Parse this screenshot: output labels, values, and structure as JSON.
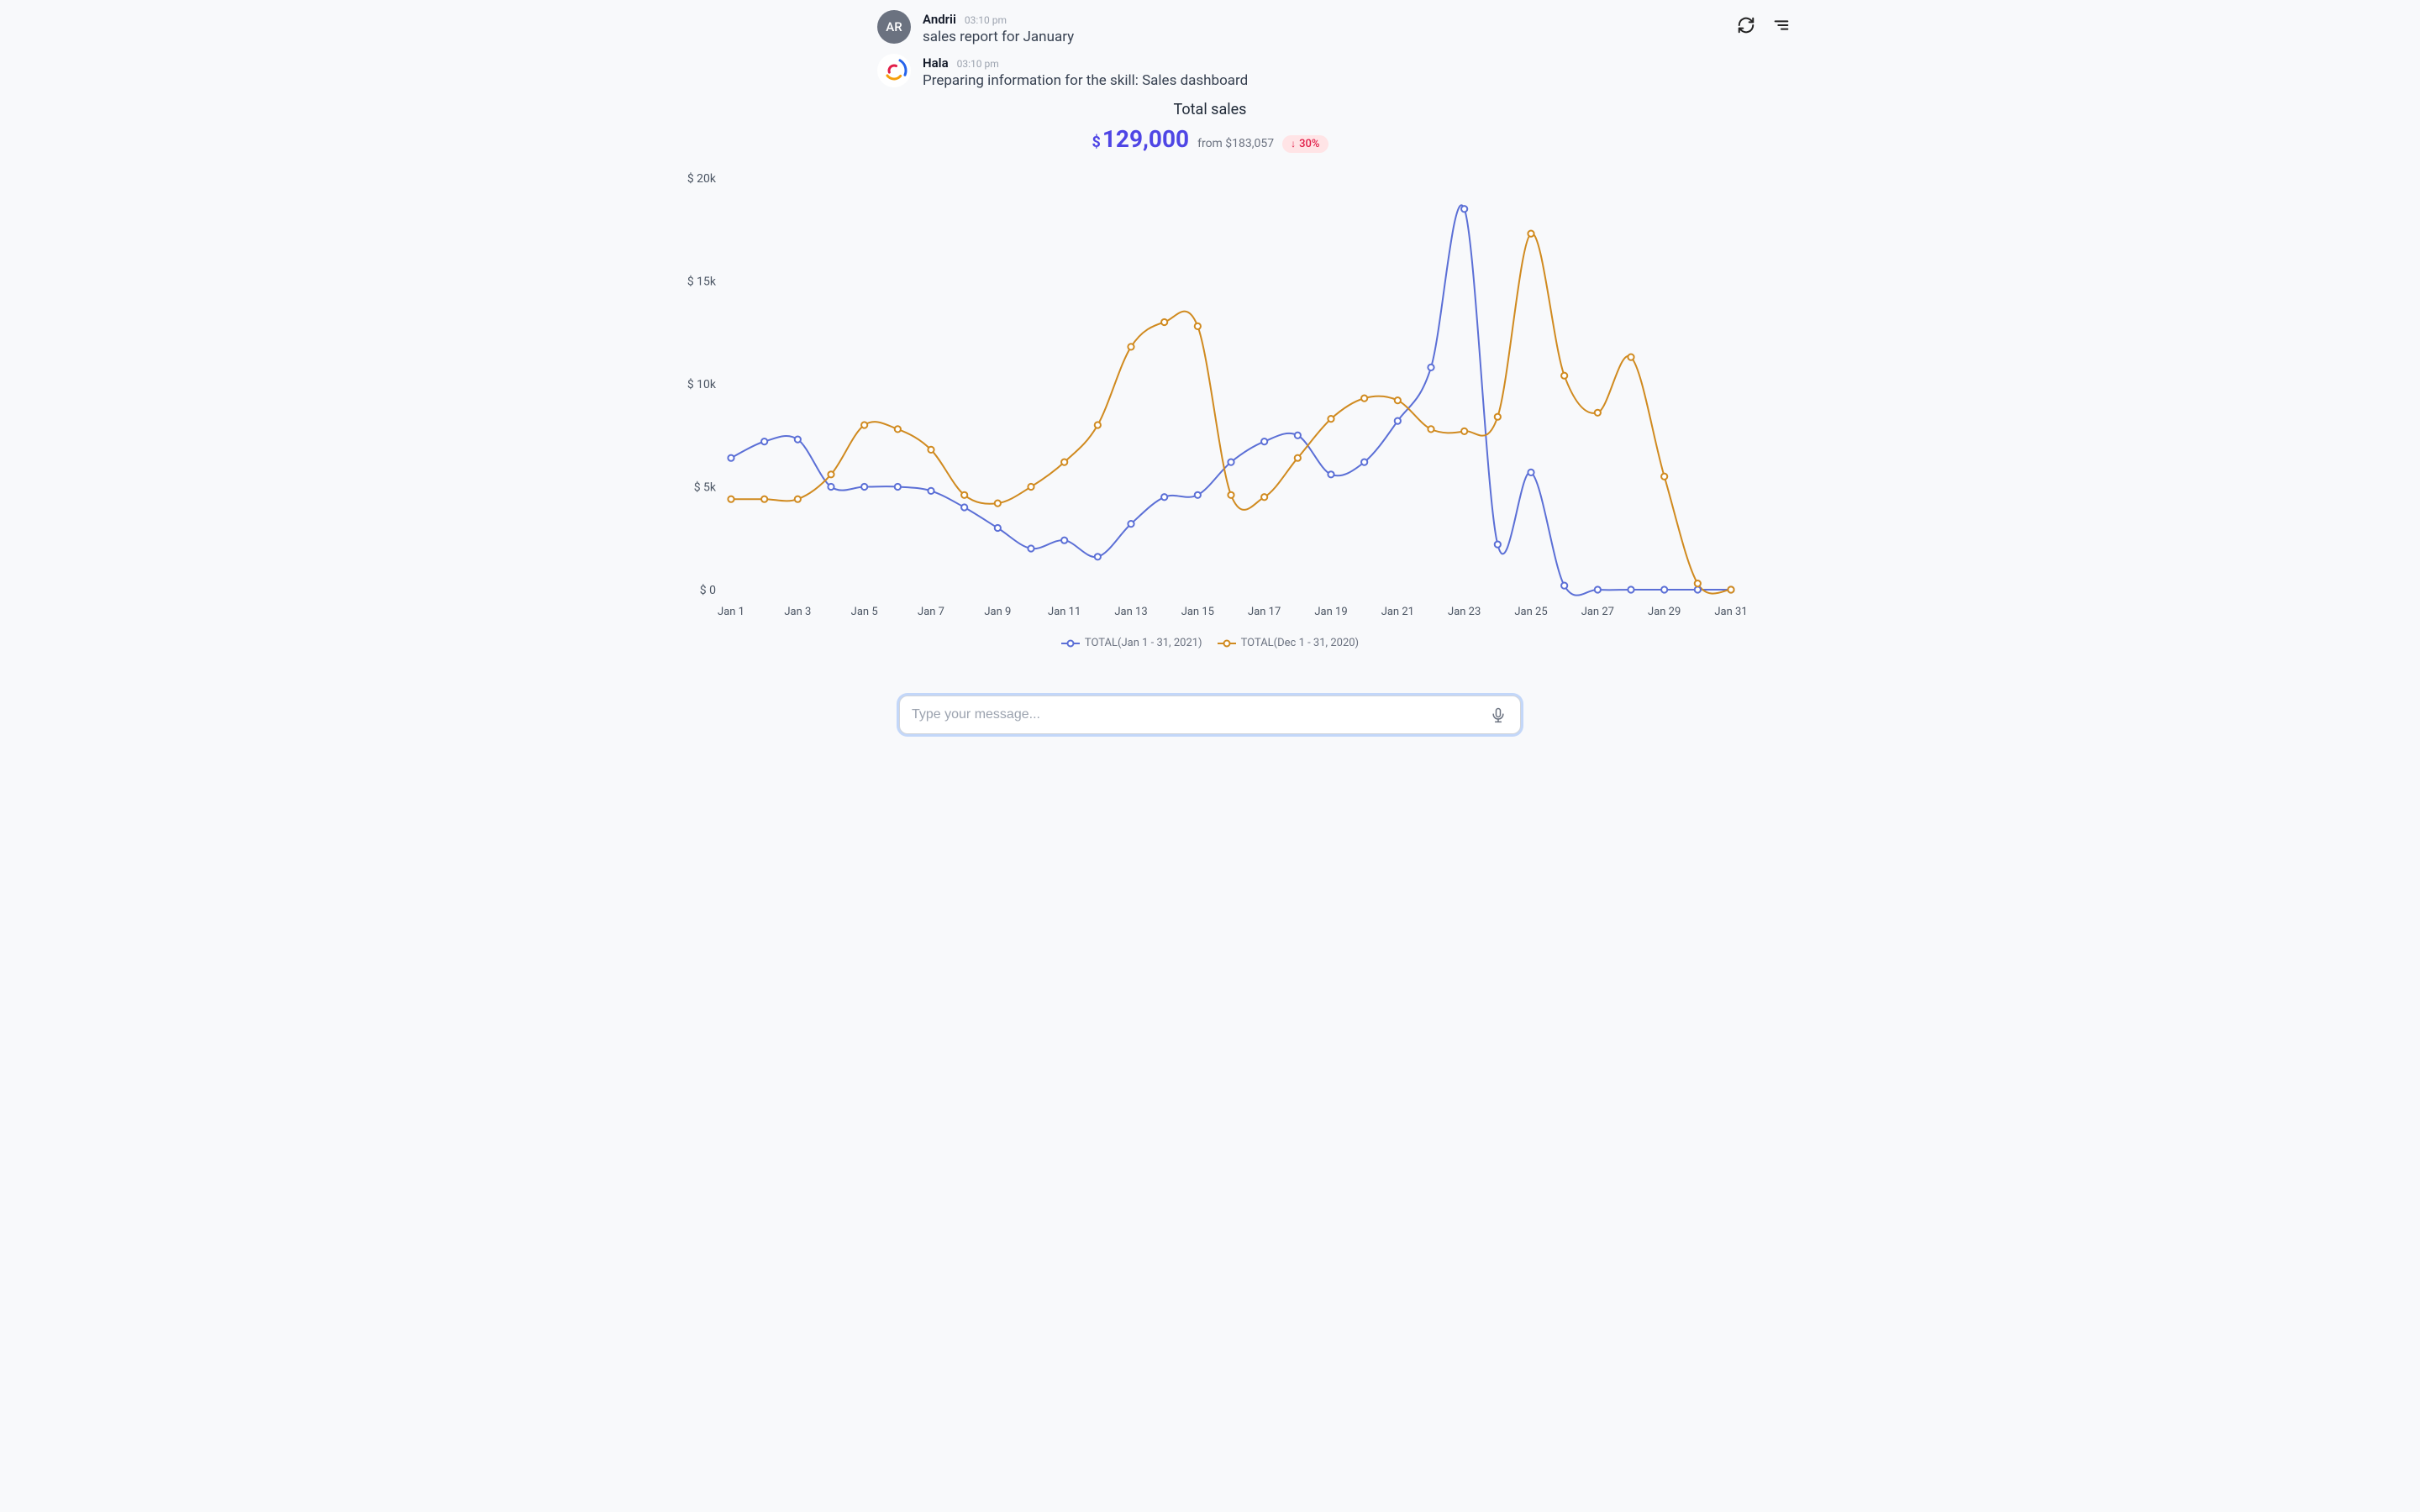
{
  "header": {
    "refresh_icon": "refresh",
    "menu_icon": "menu"
  },
  "messages": [
    {
      "avatar_initials": "AR",
      "name": "Andrii",
      "time": "03:10 pm",
      "text": "sales report for January"
    },
    {
      "avatar_initials": "",
      "name": "Hala",
      "time": "03:10 pm",
      "text": "Preparing information for the skill: Sales dashboard"
    }
  ],
  "dashboard": {
    "title": "Total sales",
    "currency": "$",
    "value": "129,000",
    "from_label": "from $183,057",
    "change_direction": "down",
    "change_pct": "30%"
  },
  "input": {
    "placeholder": "Type your message..."
  },
  "legend": {
    "series1": "TOTAL(Jan 1 - 31, 2021)",
    "series2": "TOTAL(Dec 1 - 31, 2020)"
  },
  "chart_data": {
    "type": "line",
    "xlabel": "",
    "ylabel": "",
    "ylim": [
      0,
      20000
    ],
    "y_ticks": [
      "$ 0",
      "$ 5k",
      "$ 10k",
      "$ 15k",
      "$ 20k"
    ],
    "x_ticks": [
      "Jan 1",
      "Jan 3",
      "Jan 5",
      "Jan 7",
      "Jan 9",
      "Jan 11",
      "Jan 13",
      "Jan 15",
      "Jan 17",
      "Jan 19",
      "Jan 21",
      "Jan 23",
      "Jan 25",
      "Jan 27",
      "Jan 29",
      "Jan 31"
    ],
    "categories": [
      "Jan 1",
      "Jan 2",
      "Jan 3",
      "Jan 4",
      "Jan 5",
      "Jan 6",
      "Jan 7",
      "Jan 8",
      "Jan 9",
      "Jan 10",
      "Jan 11",
      "Jan 12",
      "Jan 13",
      "Jan 14",
      "Jan 15",
      "Jan 16",
      "Jan 17",
      "Jan 18",
      "Jan 19",
      "Jan 20",
      "Jan 21",
      "Jan 22",
      "Jan 23",
      "Jan 24",
      "Jan 25",
      "Jan 26",
      "Jan 27",
      "Jan 28",
      "Jan 29",
      "Jan 30",
      "Jan 31"
    ],
    "series": [
      {
        "name": "TOTAL(Jan 1 - 31, 2021)",
        "color": "#5b6fd6",
        "values": [
          6400,
          7200,
          7300,
          5000,
          5000,
          5000,
          4800,
          4000,
          3000,
          2000,
          2400,
          1600,
          3200,
          4500,
          4600,
          6200,
          7200,
          7500,
          5600,
          6200,
          8200,
          10800,
          18500,
          2200,
          5700,
          200,
          0,
          0,
          0,
          0,
          0
        ]
      },
      {
        "name": "TOTAL(Dec 1 - 31, 2020)",
        "color": "#d08a1f",
        "values": [
          4400,
          4400,
          4400,
          5600,
          8000,
          7800,
          6800,
          4600,
          4200,
          5000,
          6200,
          8000,
          11800,
          13000,
          12800,
          4600,
          4500,
          6400,
          8300,
          9300,
          9200,
          7800,
          7700,
          8400,
          17300,
          10400,
          8600,
          11300,
          5500,
          300,
          0
        ]
      }
    ]
  }
}
